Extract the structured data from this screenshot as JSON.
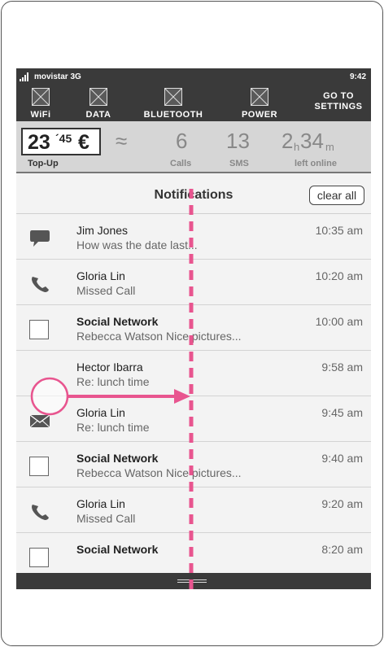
{
  "status_bar": {
    "carrier": "movistar 3G",
    "time": "9:42"
  },
  "toggles": [
    {
      "label": "WiFi"
    },
    {
      "label": "DATA"
    },
    {
      "label": "BLUETOOTH"
    },
    {
      "label": "POWER"
    }
  ],
  "settings_button": {
    "line1": "GO TO",
    "line2": "SETTINGS"
  },
  "credit": {
    "balance_int": "23",
    "balance_dec": "´45",
    "currency": "€",
    "topup_label": "Top-Up",
    "approx_symbol": "≈",
    "calls_value": "6",
    "calls_label": "Calls",
    "sms_value": "13",
    "sms_label": "SMS",
    "hours_value": "2",
    "hours_unit": "h",
    "minutes_value": "34",
    "minutes_unit": "m",
    "online_label": "left online"
  },
  "notifications": {
    "title": "Notifications",
    "clear_label": "clear all",
    "items": [
      {
        "icon": "chat-bubble-icon",
        "title": "Jim Jones",
        "subtitle": "How was the date last...",
        "time": "10:35 am",
        "bold": false
      },
      {
        "icon": "phone-icon",
        "title": "Gloria Lin",
        "subtitle": "Missed Call",
        "time": "10:20 am",
        "bold": false
      },
      {
        "icon": "checkbox-icon",
        "title": "Social Network",
        "subtitle": "Rebecca Watson  Nice pictures...",
        "time": "10:00 am",
        "bold": true
      },
      {
        "icon": "none",
        "title": "Hector Ibarra",
        "subtitle": "Re: lunch time",
        "time": "9:58 am",
        "bold": false
      },
      {
        "icon": "envelope-icon",
        "title": "Gloria Lin",
        "subtitle": "Re: lunch time",
        "time": "9:45 am",
        "bold": false
      },
      {
        "icon": "checkbox-icon",
        "title": "Social Network",
        "subtitle": "Rebecca Watson  Nice pictures...",
        "time": "9:40 am",
        "bold": true
      },
      {
        "icon": "phone-icon",
        "title": "Gloria Lin",
        "subtitle": "Missed Call",
        "time": "9:20 am",
        "bold": false
      },
      {
        "icon": "checkbox-icon",
        "title": "Social Network",
        "subtitle": "",
        "time": "8:20 am",
        "bold": true
      }
    ]
  },
  "colors": {
    "dark_bar": "#3a3a3a",
    "credit_bg": "#d6d6d6",
    "panel_bg": "#f3f3f3",
    "gesture_pink": "#e8558f"
  }
}
